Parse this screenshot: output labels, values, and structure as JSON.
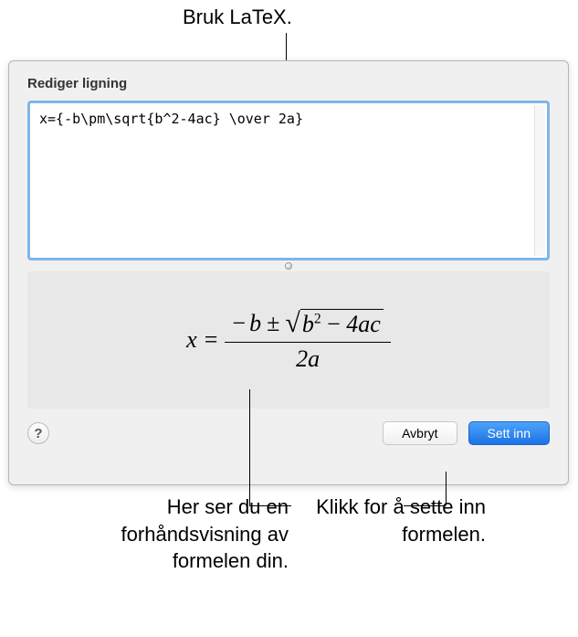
{
  "callouts": {
    "top": "Bruk LaTeX.",
    "preview": "Her ser du en forhåndsvisning av formelen din.",
    "insert": "Klikk for å sette inn formelen."
  },
  "dialog": {
    "title": "Rediger ligning",
    "latex_input": "x={-b\\pm\\sqrt{b^2-4ac} \\over 2a}",
    "buttons": {
      "help": "?",
      "cancel": "Avbryt",
      "insert": "Sett inn"
    }
  },
  "preview_formula": {
    "lhs": "x",
    "equals": "=",
    "numerator_prefix": "−b ±",
    "radicand": "b",
    "radicand_exp": "2",
    "radicand_suffix": " − 4ac",
    "denominator": "2a"
  }
}
